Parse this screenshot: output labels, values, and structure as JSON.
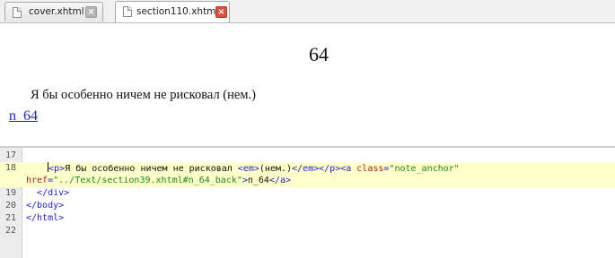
{
  "tabs": [
    {
      "label": "cover.xhtml",
      "active": false,
      "close": "×"
    },
    {
      "label": "section110.xhtml",
      "active": true,
      "close": "×"
    }
  ],
  "preview": {
    "heading": "64",
    "paragraph": "Я бы особенно ничем не рисковал (нем.)",
    "note_link": "n_64"
  },
  "code": {
    "lines": [
      {
        "num": "17",
        "indent": "",
        "parts": []
      },
      {
        "num": "18",
        "indent": "    ",
        "highlighted": true,
        "parts": [
          {
            "t": "tag",
            "s": "<p>"
          },
          {
            "t": "text",
            "s": "Я бы особенно ничем не рисковал "
          },
          {
            "t": "tag",
            "s": "<em>"
          },
          {
            "t": "text",
            "s": "(нем.)"
          },
          {
            "t": "tag",
            "s": "</em></p><a "
          },
          {
            "t": "attr",
            "s": "class"
          },
          {
            "t": "tag",
            "s": "="
          },
          {
            "t": "val",
            "s": "\"note_anchor\""
          }
        ]
      },
      {
        "num": "",
        "indent": "",
        "highlighted": true,
        "parts": [
          {
            "t": "attr",
            "s": "href"
          },
          {
            "t": "tag",
            "s": "="
          },
          {
            "t": "val",
            "s": "\"../Text/section39.xhtml#n_64_back\""
          },
          {
            "t": "tag",
            "s": ">"
          },
          {
            "t": "text",
            "s": "n_64"
          },
          {
            "t": "tag",
            "s": "</a>"
          }
        ]
      },
      {
        "num": "19",
        "indent": "  ",
        "parts": [
          {
            "t": "tag",
            "s": "</div>"
          }
        ]
      },
      {
        "num": "20",
        "indent": "",
        "parts": [
          {
            "t": "tag",
            "s": "</body>"
          }
        ]
      },
      {
        "num": "21",
        "indent": "",
        "parts": [
          {
            "t": "tag",
            "s": "</html>"
          }
        ]
      },
      {
        "num": "22",
        "indent": "",
        "parts": []
      }
    ]
  },
  "colors": {
    "tag": "#2323c8",
    "attribute": "#b02020",
    "value": "#1f8a1f",
    "current_line": "#ffffcc",
    "active_tab_close": "#e0513a"
  },
  "icons": [
    "document-icon",
    "close-icon"
  ]
}
